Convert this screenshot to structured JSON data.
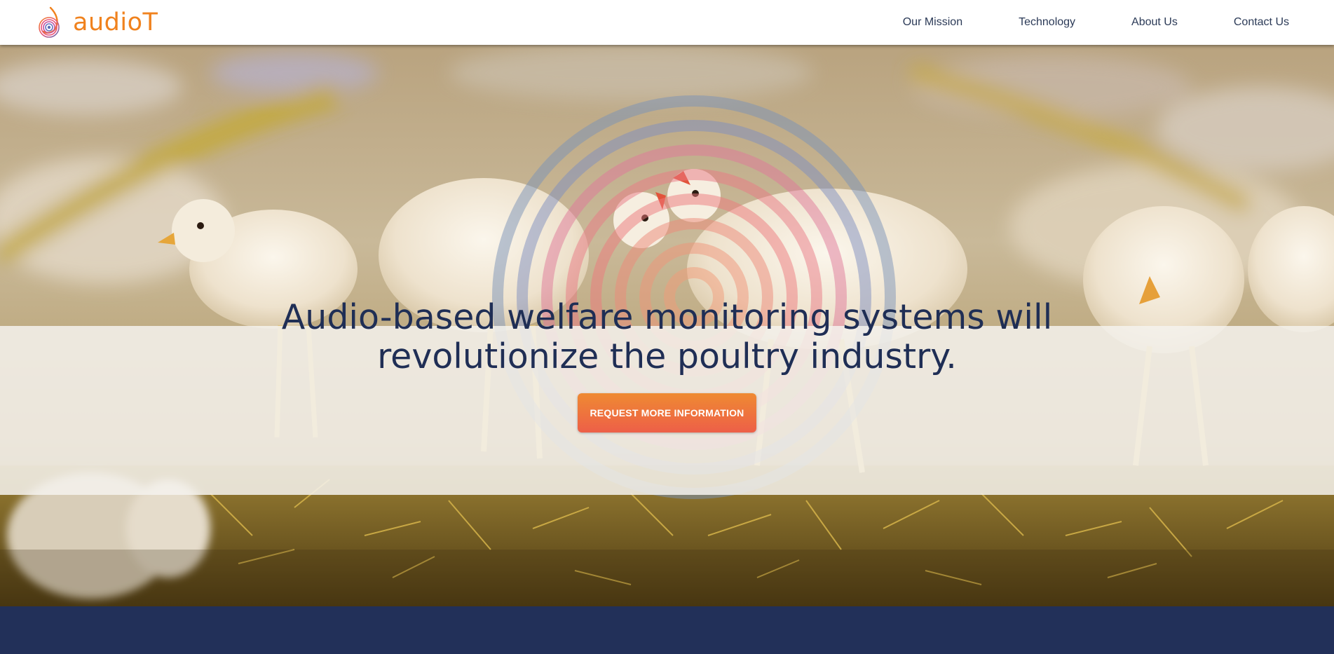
{
  "brand": {
    "name": "audioT",
    "color": "#f0821e"
  },
  "nav": {
    "items": [
      {
        "label": "Our Mission"
      },
      {
        "label": "Technology"
      },
      {
        "label": "About Us"
      },
      {
        "label": "Contact Us"
      }
    ]
  },
  "hero": {
    "headline": "Audio-based welfare monitoring systems will revolutionize the poultry industry.",
    "cta_label": "REQUEST MORE INFORMATION",
    "headline_color": "#1f2e55",
    "cta_colors": [
      "#ef8a32",
      "#ed5f48"
    ]
  },
  "next_section": {
    "background": "#223059"
  }
}
